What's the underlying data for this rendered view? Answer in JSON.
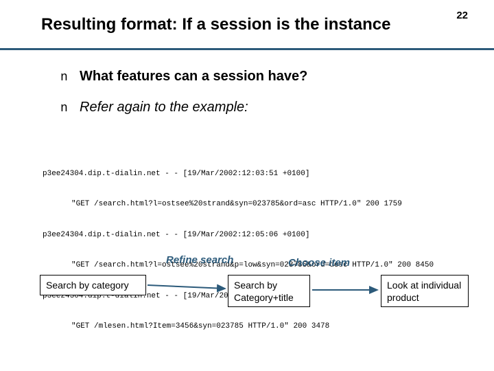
{
  "page_number": "22",
  "title": "Resulting format: If a session is the instance",
  "bullets": [
    {
      "marker": "n",
      "text": "What features can a session have?",
      "style": "bold"
    },
    {
      "marker": "n",
      "text": "Refer again to the example:",
      "style": "italic"
    }
  ],
  "log_lines": [
    {
      "indent": false,
      "text": "p3ee24304.dip.t-dialin.net - - [19/Mar/2002:12:03:51 +0100]"
    },
    {
      "indent": true,
      "text": "\"GET /search.html?l=ostsee%20strand&syn=023785&ord=asc HTTP/1.0\" 200 1759"
    },
    {
      "indent": false,
      "text": "p3ee24304.dip.t-dialin.net - - [19/Mar/2002:12:05:06 +0100]"
    },
    {
      "indent": true,
      "text": "\"GET /search.html?l=ostsee%20strand&p=low&syn=023785&ord=desc HTTP/1.0\" 200 8450"
    },
    {
      "indent": false,
      "text": "p3ee24304.dip.t-dialin.net - - [19/Mar/2002:12:06:41 +0100]"
    },
    {
      "indent": true,
      "text": "\"GET /mlesen.html?Item=3456&syn=023785 HTTP/1.0\" 200 3478"
    }
  ],
  "annotations": {
    "refine_label": "Refine search",
    "choose_label": "Choose item",
    "box1": "Search by category",
    "box2": "Search by Category+title",
    "box3": "Look at individual product"
  },
  "colors": {
    "accent": "#2c5a7a"
  }
}
